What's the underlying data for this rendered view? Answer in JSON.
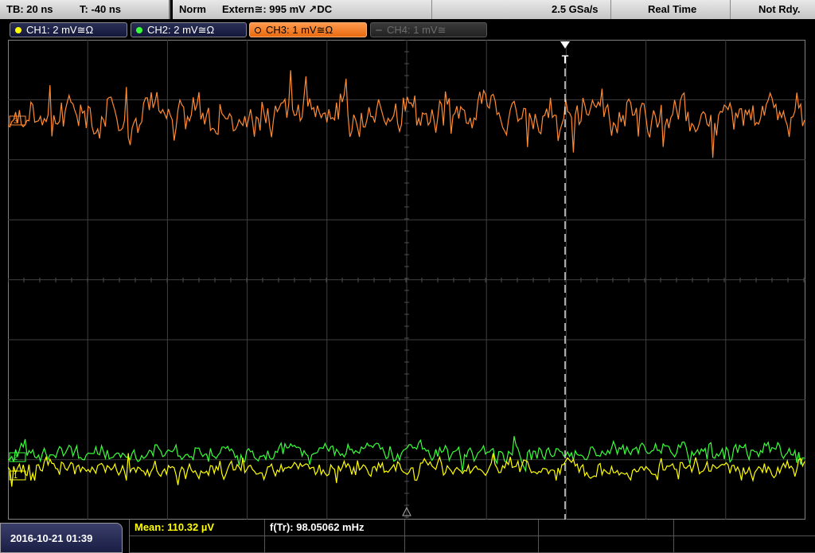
{
  "topbar": {
    "timebase": "TB: 20 ns",
    "trigger_offset": "T: -40 ns",
    "trigger_mode": "Norm",
    "trigger_source": "Extern≅: 995 mV ↗DC",
    "sample_rate": "2.5 GSa/s",
    "acq_mode": "Real Time",
    "status": "Not Rdy."
  },
  "channels": [
    {
      "label": "CH1: 2 mV≅Ω",
      "color": "#ffff00"
    },
    {
      "label": "CH2: 2 mV≅Ω",
      "color": "#39ff39"
    },
    {
      "label": "CH3: 1 mV≅Ω",
      "color": "#ff8a33"
    },
    {
      "label": "CH4: 1 mV≅",
      "color": "#6b6b6b"
    }
  ],
  "markers": {
    "ch1": "1",
    "ch2": "2",
    "ch3": "3",
    "trigger": "T"
  },
  "bottombar": {
    "datetime": "2016-10-21 01:39",
    "mean": "Mean: 110.32 µV",
    "freq": "f(Tr): 98.05062 mHz"
  }
}
